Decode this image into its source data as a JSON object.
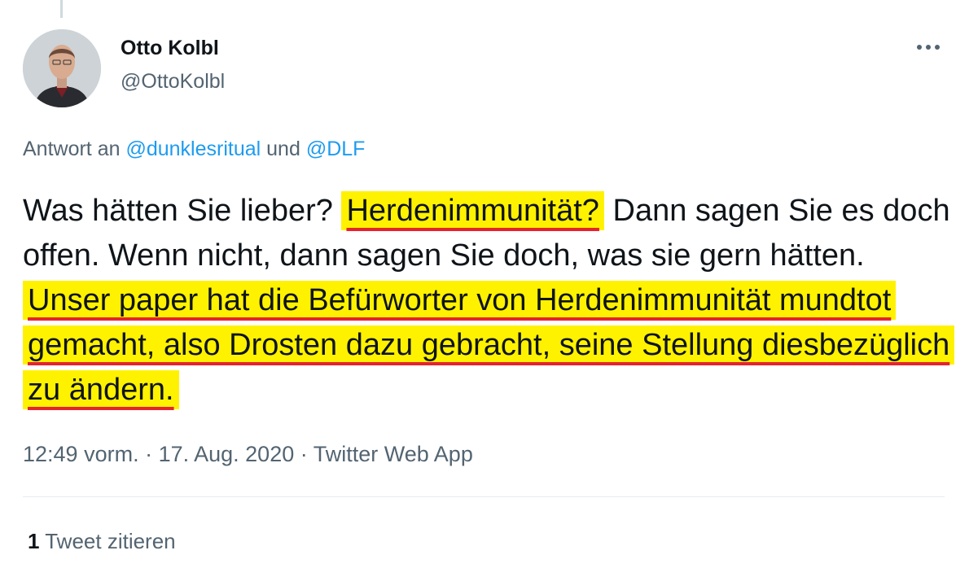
{
  "tweet": {
    "author": {
      "name": "Otto Kolbl",
      "handle": "@OttoKolbl"
    },
    "reply_prefix": "Antwort an ",
    "reply_mention_1": "@dunklesritual",
    "reply_joiner": " und ",
    "reply_mention_2": "@DLF",
    "text_part_1": "Was hätten Sie lieber? ",
    "highlight_1": "Herdenimmunität?",
    "text_part_2": " Dann sagen Sie es doch offen. Wenn nicht, dann sagen Sie doch, was sie gern hätten. ",
    "highlight_2": "Unser paper hat die Befürworter von Herdenimmunität mundtot gemacht, also Drosten dazu gebracht, seine Stellung diesbezüglich zu ändern.",
    "time": "12:49 vorm.",
    "date": "17. Aug. 2020",
    "separator": " · ",
    "source": "Twitter Web App",
    "quote_count": "1",
    "quote_label": " Tweet zitieren"
  },
  "icons": {
    "more": "more-dots-icon"
  },
  "colors": {
    "highlight": "#fff200",
    "underline": "#e6232d",
    "link": "#1d9bf0",
    "secondary": "#536471"
  }
}
